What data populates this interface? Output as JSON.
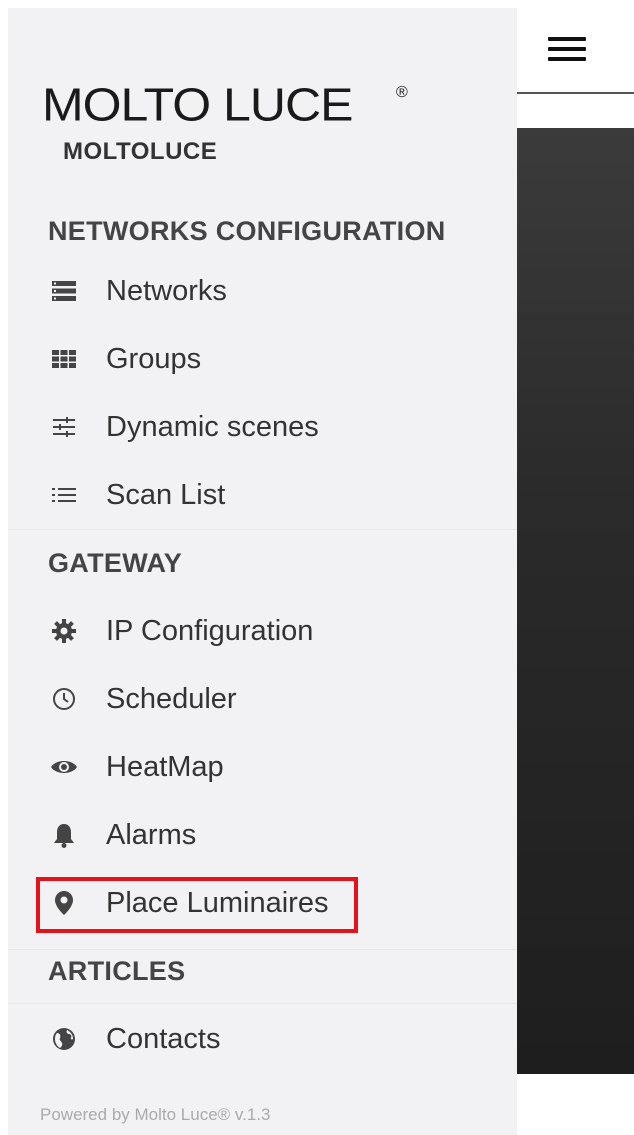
{
  "brand": {
    "logo_text": "MOLTO LUCE",
    "logo_reg": "®",
    "subtitle": "MOLTOLUCE"
  },
  "sections": {
    "networks_configuration": "NETWORKS CONFIGURATION",
    "gateway": "GATEWAY",
    "articles": "ARTICLES"
  },
  "menu": {
    "networks": "Networks",
    "groups": "Groups",
    "dynamic_scenes": "Dynamic scenes",
    "scan_list": "Scan List",
    "ip_configuration": "IP Configuration",
    "scheduler": "Scheduler",
    "heatmap": "HeatMap",
    "alarms": "Alarms",
    "place_luminaires": "Place Luminaires",
    "contacts": "Contacts"
  },
  "footer": "Powered by Molto Luce® v.1.3",
  "colors": {
    "drawer_bg": "#f2f2f4",
    "highlight": "#e3121b",
    "icon": "#444444"
  }
}
